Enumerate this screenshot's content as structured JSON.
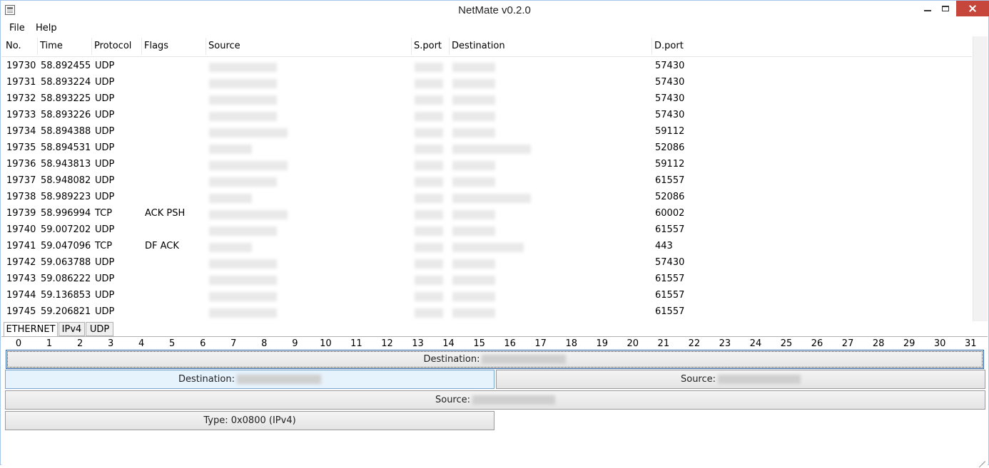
{
  "window": {
    "title": "NetMate v0.2.0"
  },
  "menu": {
    "items": [
      "File",
      "Help"
    ]
  },
  "table": {
    "columns": [
      "No.",
      "Time",
      "Protocol",
      "Flags",
      "Source",
      "S.port",
      "Destination",
      "D.port"
    ],
    "rows": [
      {
        "no": "19730",
        "time": "58.892455",
        "protocol": "UDP",
        "flags": "",
        "dport": "57430"
      },
      {
        "no": "19731",
        "time": "58.893224",
        "protocol": "UDP",
        "flags": "",
        "dport": "57430"
      },
      {
        "no": "19732",
        "time": "58.893225",
        "protocol": "UDP",
        "flags": "",
        "dport": "57430"
      },
      {
        "no": "19733",
        "time": "58.893226",
        "protocol": "UDP",
        "flags": "",
        "dport": "57430"
      },
      {
        "no": "19734",
        "time": "58.894388",
        "protocol": "UDP",
        "flags": "",
        "dport": "59112"
      },
      {
        "no": "19735",
        "time": "58.894531",
        "protocol": "UDP",
        "flags": "",
        "dport": "52086"
      },
      {
        "no": "19736",
        "time": "58.943813",
        "protocol": "UDP",
        "flags": "",
        "dport": "59112"
      },
      {
        "no": "19737",
        "time": "58.948082",
        "protocol": "UDP",
        "flags": "",
        "dport": "61557"
      },
      {
        "no": "19738",
        "time": "58.989223",
        "protocol": "UDP",
        "flags": "",
        "dport": "52086"
      },
      {
        "no": "19739",
        "time": "58.996994",
        "protocol": "TCP",
        "flags": "ACK PSH",
        "dport": "60002"
      },
      {
        "no": "19740",
        "time": "59.007202",
        "protocol": "UDP",
        "flags": "",
        "dport": "61557"
      },
      {
        "no": "19741",
        "time": "59.047096",
        "protocol": "TCP",
        "flags": "DF ACK",
        "dport": "443"
      },
      {
        "no": "19742",
        "time": "59.063788",
        "protocol": "UDP",
        "flags": "",
        "dport": "57430"
      },
      {
        "no": "19743",
        "time": "59.086222",
        "protocol": "UDP",
        "flags": "",
        "dport": "61557"
      },
      {
        "no": "19744",
        "time": "59.136853",
        "protocol": "UDP",
        "flags": "",
        "dport": "61557"
      },
      {
        "no": "19745",
        "time": "59.206821",
        "protocol": "UDP",
        "flags": "",
        "dport": "61557"
      }
    ]
  },
  "tabs": [
    "ETHERNET",
    "IPv4",
    "UDP"
  ],
  "active_tab": "ETHERNET",
  "bit_ruler": [
    "0",
    "1",
    "2",
    "3",
    "4",
    "5",
    "6",
    "7",
    "8",
    "9",
    "10",
    "11",
    "12",
    "13",
    "14",
    "15",
    "16",
    "17",
    "18",
    "19",
    "20",
    "21",
    "22",
    "23",
    "24",
    "25",
    "26",
    "27",
    "28",
    "29",
    "30",
    "31"
  ],
  "fields": {
    "destination_full": "Destination:",
    "destination_half": "Destination:",
    "source_half": "Source:",
    "source_full": "Source:",
    "type": "Type: 0x0800 (IPv4)"
  },
  "colors": {
    "close_button": "#c7463c",
    "selected_field": "#e6f2fc",
    "window_border": "#a6c6ea"
  }
}
